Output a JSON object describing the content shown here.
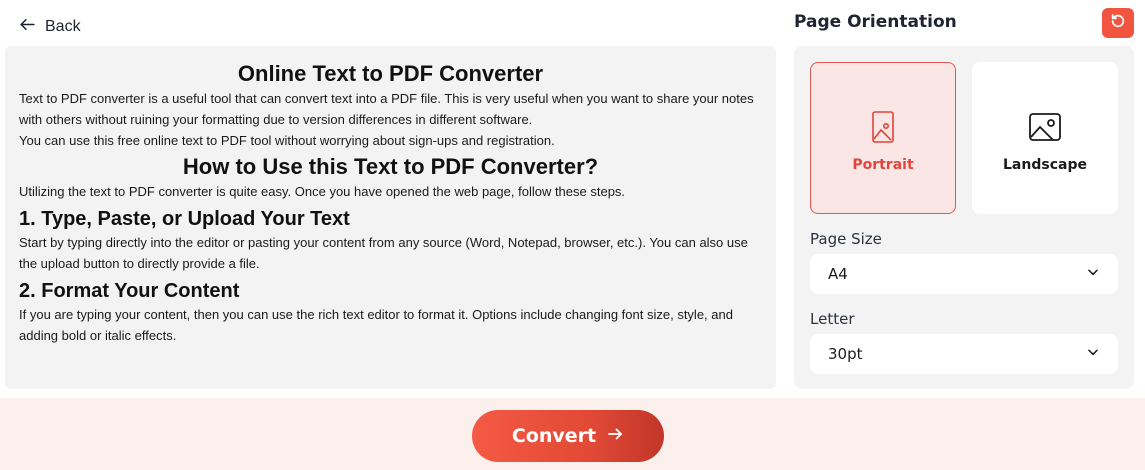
{
  "nav": {
    "back_label": "Back"
  },
  "content": {
    "title": "Online Text to PDF Converter",
    "intro_p1": "Text to PDF converter is a useful tool that can convert text into a PDF file. This is very useful when you want to share your notes with others without ruining your formatting due to version differences in different software.",
    "intro_p2": "You can use this free online text to PDF tool without worrying about sign-ups and registration.",
    "howto_title": "How to Use this Text to PDF Converter?",
    "howto_p": "Utilizing the text to PDF converter is quite easy. Once you have opened the web page, follow these steps.",
    "step1_title": "1. Type, Paste, or Upload Your Text",
    "step1_p": "Start by typing directly into the editor or pasting your content from any source (Word, Notepad, browser, etc.). You can also use the upload button to directly provide a file.",
    "step2_title": "2. Format Your Content",
    "step2_p": "If you are typing your content, then you can use the rich text editor to format it. Options include changing font size, style, and adding bold or italic effects."
  },
  "settings": {
    "orientation_title": "Page Orientation",
    "portrait_label": "Portrait",
    "landscape_label": "Landscape",
    "selected_orientation": "Portrait",
    "page_size_label": "Page Size",
    "page_size_value": "A4",
    "margin_label": "Letter",
    "margin_value": "30pt"
  },
  "actions": {
    "convert_label": "Convert"
  },
  "colors": {
    "accent": "#f2553f",
    "selected_bg": "#f9e6e5",
    "bottom_bar": "#fbf0ec"
  },
  "icons": [
    "arrow-left-icon",
    "reset-icon",
    "portrait-image-icon",
    "landscape-image-icon",
    "chevron-down-icon",
    "arrow-right-icon"
  ]
}
